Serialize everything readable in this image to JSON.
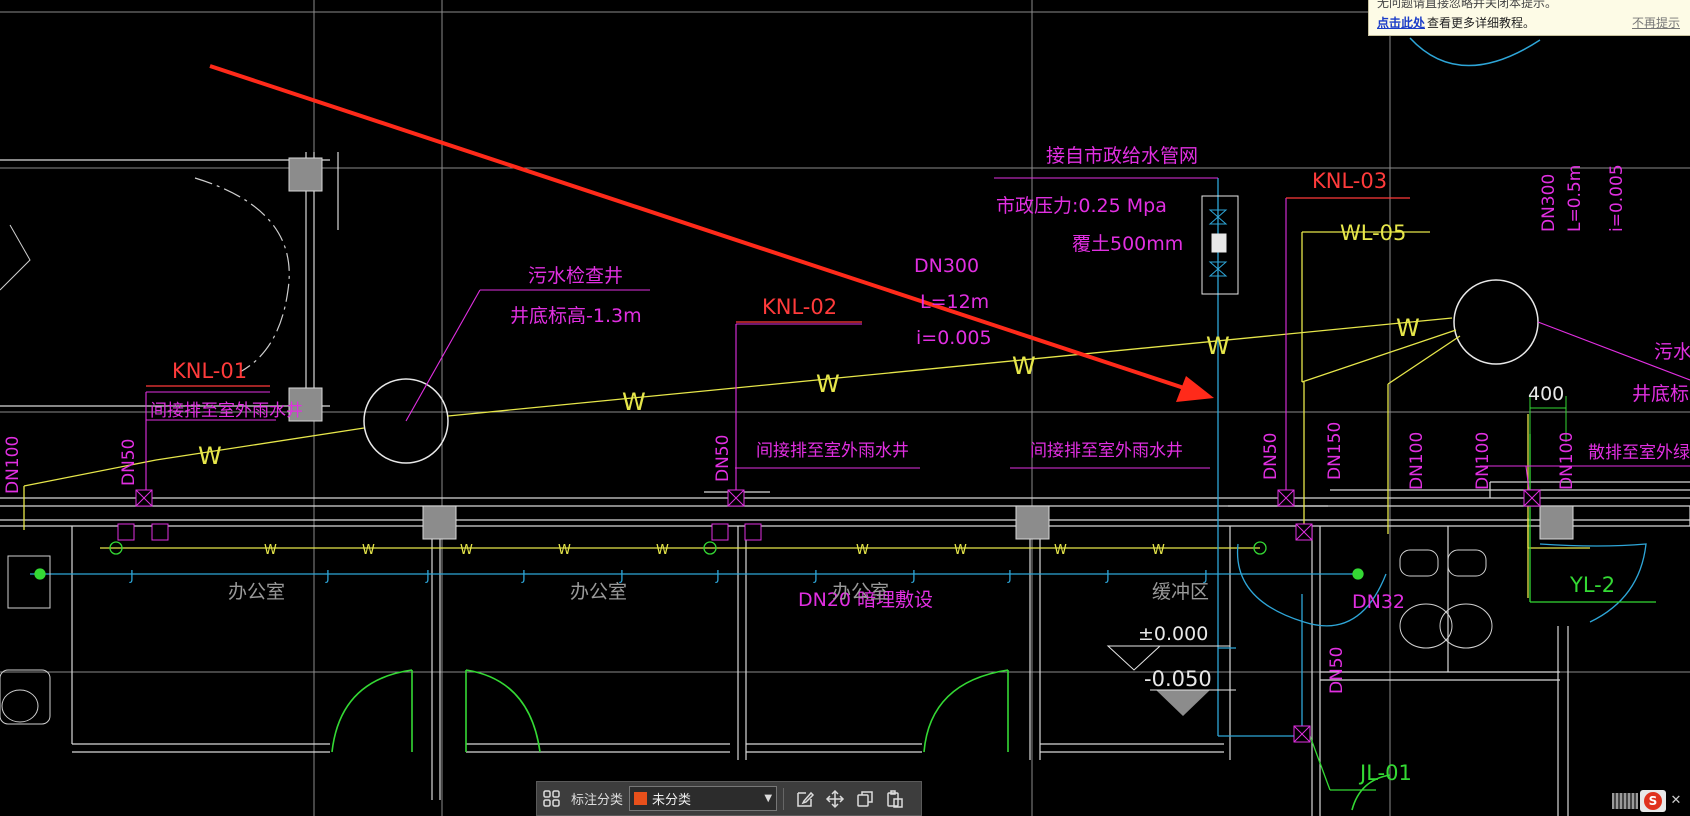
{
  "drawing": {
    "labels": {
      "sewage_well_name": "污水检查井",
      "sewage_well_elev": "井底标高-1.3m",
      "knl01": "KNL-01",
      "knl02": "KNL-02",
      "knl03": "KNL-03",
      "wl05": "WL-05",
      "indirect_rain_1": "间接排至室外雨水井",
      "indirect_rain_2": "间接排至室外雨水井",
      "indirect_rain_3": "间接排至室外雨水井",
      "dn300_a": "DN300",
      "pipe_len_a": "L=12m",
      "pipe_slope_a": "i=0.005",
      "dn300_b": "DN300",
      "pipe_len_b": "L=0.5m",
      "pipe_slope_b": "i=0.005",
      "municipal_supply": "接自市政给水管网",
      "municipal_pressure": "市政压力:0.25 Mpa",
      "cover_soil": "覆土500mm",
      "dn100_left": "DN100",
      "dn50_1": "DN50",
      "dn50_2": "DN50",
      "dn50_3": "DN50",
      "dn50_4": "DN50",
      "dn150": "DN150",
      "dn100_1": "DN100",
      "dn100_2": "DN100",
      "dn100_3": "DN100",
      "dn32": "DN32",
      "dn20_note": "DN20 暗埋敷设",
      "dim_400": "400",
      "scatter_green": "散排至室外绿化",
      "sewage_right": "污水",
      "well_elev_right": "井底标高",
      "yl2": "YL-2",
      "jl01": "JL-01",
      "elev_zero": "±0.000",
      "elev_neg": "-0.050",
      "room_office_1": "办公室",
      "room_office_2": "办公室",
      "room_office_3": "办公室",
      "room_buffer": "缓冲区",
      "pipe_w": "W",
      "pipe_j": "J"
    }
  },
  "tip": {
    "top_text": "无问题请直接忽略并关闭本提示。",
    "link_text": "点击此处",
    "rest_text": "查看更多详细教程。",
    "dismiss": "不再提示"
  },
  "toolbar": {
    "label": "标注分类",
    "select_value": "未分类",
    "swatch_color": "#e8501b"
  },
  "colors": {
    "magenta": "#e12fe1",
    "red": "#ff3b3b",
    "yellow": "#e6e64a",
    "cyan": "#2ea6d8",
    "green": "#34d934",
    "wall": "#d8d8d8",
    "column": "#8c8c8c"
  }
}
